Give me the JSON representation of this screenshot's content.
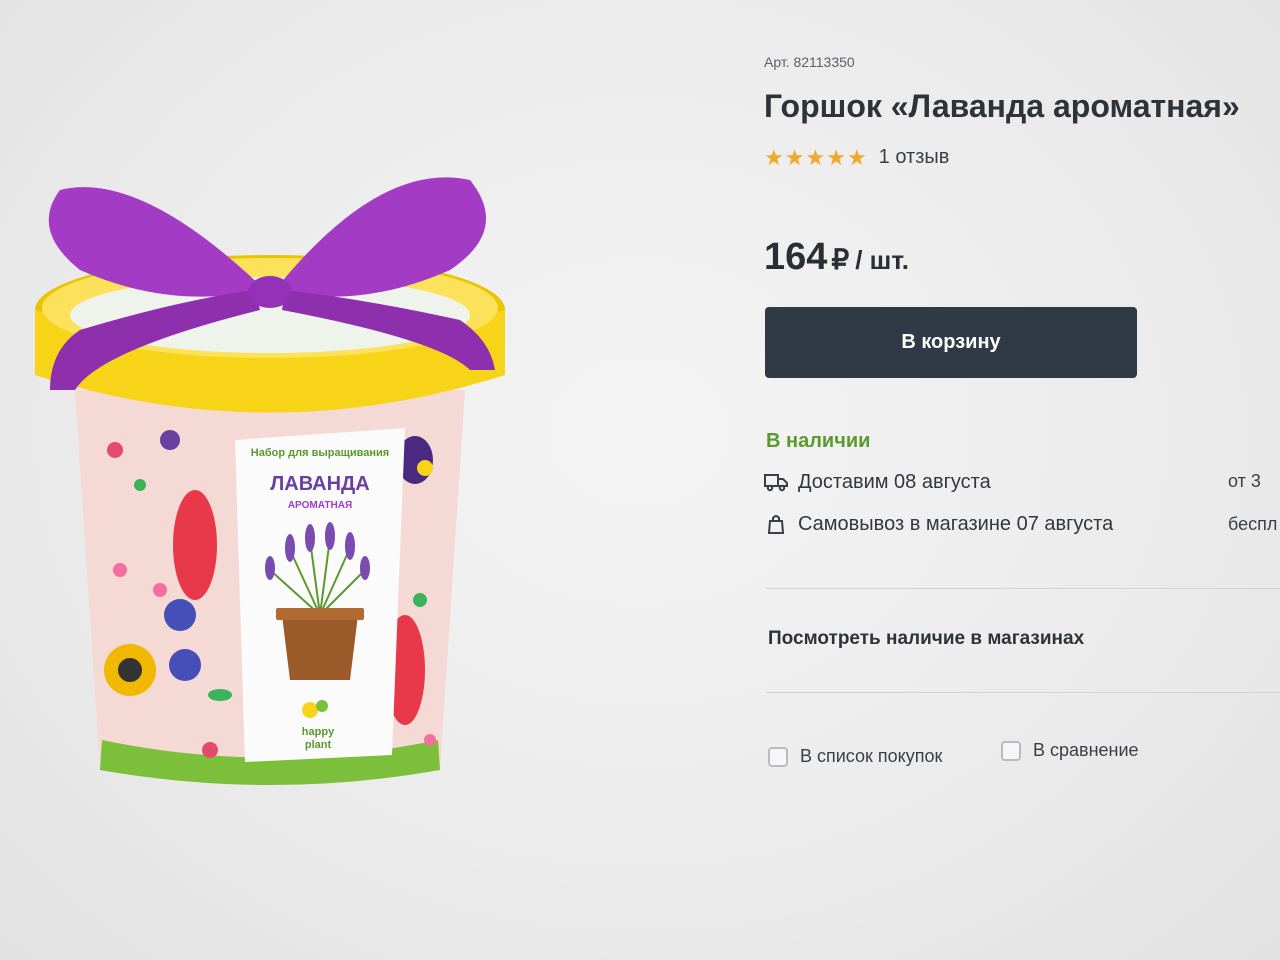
{
  "product": {
    "sku": "Арт. 82113350",
    "title": "Горшок «Лаванда ароматная»",
    "rating": {
      "stars": 5,
      "max": 5,
      "reviews_text": "1 отзыв"
    },
    "price": {
      "value": "164",
      "currency": "₽",
      "unit": "/ шт."
    },
    "cart_button": "В корзину",
    "availability": "В наличии",
    "delivery": {
      "label": "Доставим 08 августа",
      "cost_partial": "от 3",
      "icon": "truck-icon"
    },
    "pickup": {
      "label": "Самовывоз в магазине 07 августа",
      "cost_partial": "беспл",
      "icon": "bag-icon"
    },
    "stores_link": "Посмотреть наличие в магазинах",
    "shopping_list_label": "В список покупок",
    "compare_label": "В сравнение"
  },
  "package": {
    "top_text": "Набор для выращивания",
    "name": "ЛАВАНДА",
    "subname": "АРОМАТНАЯ",
    "brand_line1": "happy",
    "brand_line2": "plant"
  },
  "colors": {
    "button_bg": "#2f3a46",
    "availability_green": "#5a9a2c",
    "star": "#f1a92b",
    "ribbon": "#a33bc4",
    "lid": "#f7d417"
  }
}
